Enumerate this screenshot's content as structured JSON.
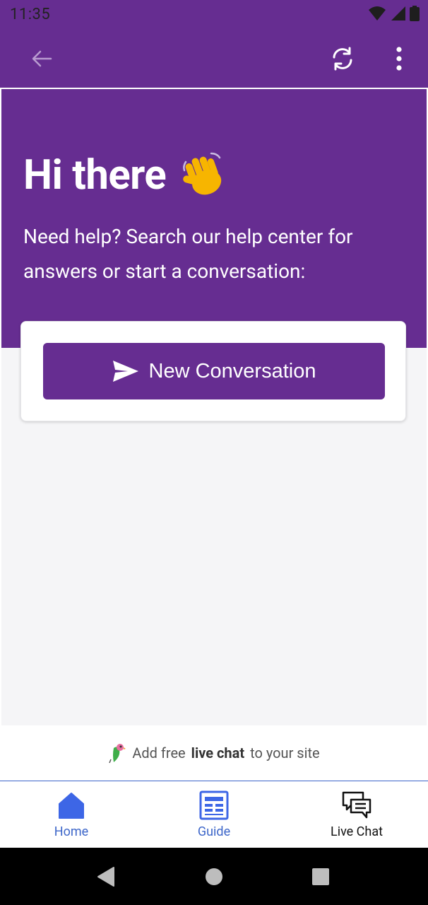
{
  "status_bar": {
    "time": "11:35"
  },
  "colors": {
    "brand": "#662d91",
    "tab_active": "#3d66c9",
    "background": "#f5f5f7"
  },
  "hero": {
    "title": "Hi there",
    "title_emoji": "👋",
    "subtitle": "Need help? Search our help center for answers or start a conversation:"
  },
  "actions": {
    "new_conversation_label": "New Conversation"
  },
  "promo": {
    "prefix": "Add free",
    "highlight": "live chat",
    "suffix": "to your site"
  },
  "tabs": [
    {
      "label": "Home",
      "icon": "home-icon",
      "active": true
    },
    {
      "label": "Guide",
      "icon": "guide-icon",
      "active": false
    },
    {
      "label": "Live Chat",
      "icon": "chat-icon",
      "active": false
    }
  ]
}
